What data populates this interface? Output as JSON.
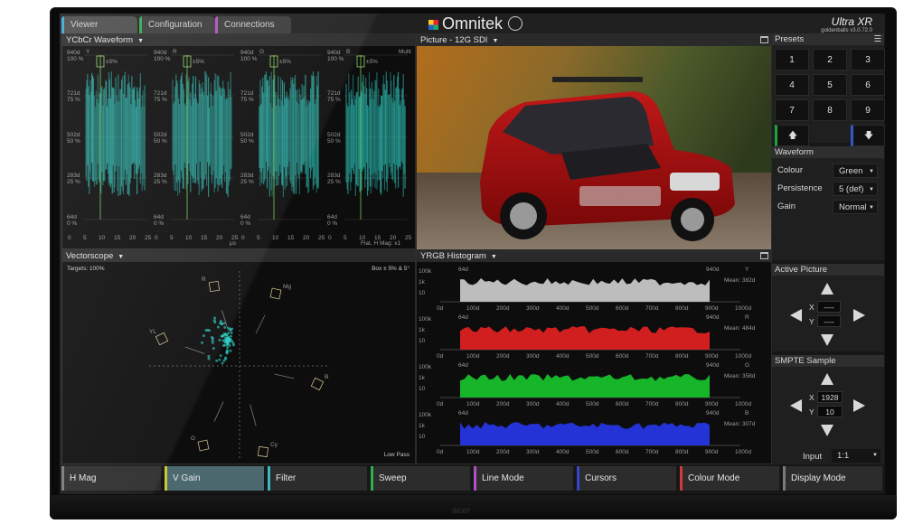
{
  "monitor": {
    "logo": "acer"
  },
  "app": {
    "brand": "Omnitek",
    "product": "Ultra XR",
    "version": "goldenballs v3.0.72.0"
  },
  "tabs": [
    {
      "label": "Viewer",
      "color": "#3aa6d6",
      "active": true
    },
    {
      "label": "Configuration",
      "color": "#2fa84f",
      "active": false
    },
    {
      "label": "Connections",
      "color": "#b04fc2",
      "active": false
    }
  ],
  "waveform": {
    "title": "YCbCr Waveform",
    "channels": [
      "Y",
      "R",
      "G",
      "B"
    ],
    "levels": [
      "940d",
      "100 %",
      "721d",
      "75 %",
      "502d",
      "50 %",
      "283d",
      "25 %",
      "64d",
      "0 %"
    ],
    "box_label": "±5%",
    "multi": "Multi",
    "xticks": [
      "0",
      "5",
      "10",
      "15",
      "20",
      "25"
    ],
    "unit": "μs",
    "footer": "Flat, H Mag: x1"
  },
  "picture": {
    "title": "Picture - 12G SDI"
  },
  "vectorscope": {
    "title": "Vectorscope",
    "targets": "Targets: 100%",
    "box": "Box ± 5% & 5°",
    "lowpass": "Low Pass",
    "markers": [
      "R",
      "Mg",
      "YL",
      "B",
      "G",
      "Cy"
    ]
  },
  "histogram": {
    "title": "YRGB Histogram",
    "scale": [
      "100k",
      "1k",
      "10"
    ],
    "xticks": [
      "0d",
      "100d",
      "200d",
      "300d",
      "400d",
      "500d",
      "600d",
      "700d",
      "800d",
      "900d",
      "1000d"
    ],
    "low": "64d",
    "high": "940d",
    "channels": [
      {
        "name": "Y",
        "mean": "Mean: 382d",
        "color": "#bdbdbd"
      },
      {
        "name": "R",
        "mean": "Mean: 484d",
        "color": "#d11f1f"
      },
      {
        "name": "G",
        "mean": "Mean: 358d",
        "color": "#17b52a"
      },
      {
        "name": "B",
        "mean": "Mean: 307d",
        "color": "#2433d6"
      }
    ]
  },
  "presets": {
    "title": "Presets",
    "keys": [
      "1",
      "2",
      "3",
      "4",
      "5",
      "6",
      "7",
      "8",
      "9"
    ],
    "load_icon": "arrow-up-icon",
    "save_icon": "arrow-down-icon"
  },
  "waveform_settings": {
    "title": "Waveform",
    "rows": [
      {
        "label": "Colour",
        "value": "Green"
      },
      {
        "label": "Persistence",
        "value": "5 (def)"
      },
      {
        "label": "Gain",
        "value": "Normal"
      }
    ]
  },
  "active_picture": {
    "title": "Active Picture",
    "x_label": "X",
    "y_label": "Y",
    "x_value": "----",
    "y_value": "----"
  },
  "smpte": {
    "title": "SMPTE Sample",
    "x_label": "X",
    "y_label": "Y",
    "x_value": "1928",
    "y_value": "10",
    "input_label": "Input",
    "input_value": "1:1"
  },
  "toolbar": [
    {
      "label": "H Mag",
      "color": "#7a7a7a",
      "active": false
    },
    {
      "label": "V Gain",
      "color": "#c9c93a",
      "active": true
    },
    {
      "label": "Filter",
      "color": "#39b7c9",
      "active": false
    },
    {
      "label": "Sweep",
      "color": "#2fb04a",
      "active": false
    },
    {
      "label": "Line Mode",
      "color": "#b34fc4",
      "active": false
    },
    {
      "label": "Cursors",
      "color": "#3847c8",
      "active": false
    },
    {
      "label": "Colour Mode",
      "color": "#d23a3a",
      "active": false
    },
    {
      "label": "Display Mode",
      "color": "#7a7a7a",
      "active": false
    }
  ]
}
